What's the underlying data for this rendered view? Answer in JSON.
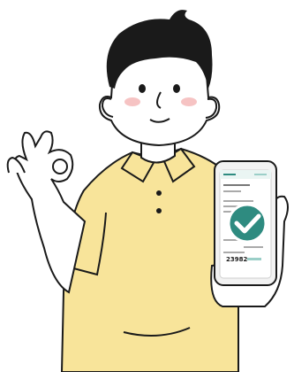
{
  "colors": {
    "shirt": "#f8e49a",
    "skin": "#ffffff",
    "hair": "#1a1a1a",
    "cheek": "#f6c3c3",
    "phone_frame": "#f2f2f2",
    "screen": "#ffffff",
    "check_circle": "#2e8b80",
    "accent_text": "#2e8b80",
    "outline": "#1a1a1a"
  },
  "phone_screen": {
    "code_number": "23982",
    "check_icon": "check-circle-icon"
  }
}
